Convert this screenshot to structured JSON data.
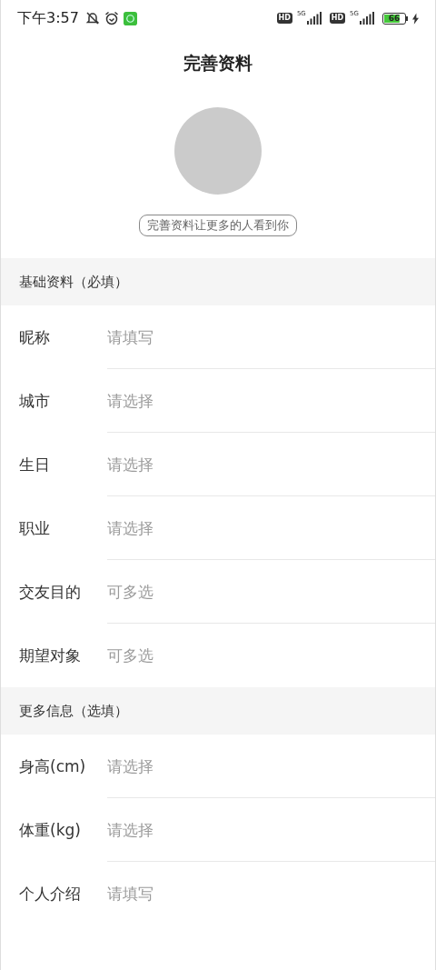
{
  "status_bar": {
    "time": "下午3:57",
    "sims": [
      {
        "badge": "HD",
        "network": "5G"
      },
      {
        "badge": "HD",
        "network": "5G"
      }
    ],
    "battery": "66"
  },
  "title": "完善资料",
  "tagline": "完善资料让更多的人看到你",
  "sections": [
    {
      "title": "基础资料（必填）",
      "fields": [
        {
          "label": "昵称",
          "placeholder": "请填写"
        },
        {
          "label": "城市",
          "placeholder": "请选择"
        },
        {
          "label": "生日",
          "placeholder": "请选择"
        },
        {
          "label": "职业",
          "placeholder": "请选择"
        },
        {
          "label": "交友目的",
          "placeholder": "可多选"
        },
        {
          "label": "期望对象",
          "placeholder": "可多选"
        }
      ]
    },
    {
      "title": "更多信息（选填）",
      "fields": [
        {
          "label": "身高(cm)",
          "placeholder": "请选择"
        },
        {
          "label": "体重(kg)",
          "placeholder": "请选择"
        },
        {
          "label": "个人介绍",
          "placeholder": "请填写"
        }
      ]
    }
  ]
}
